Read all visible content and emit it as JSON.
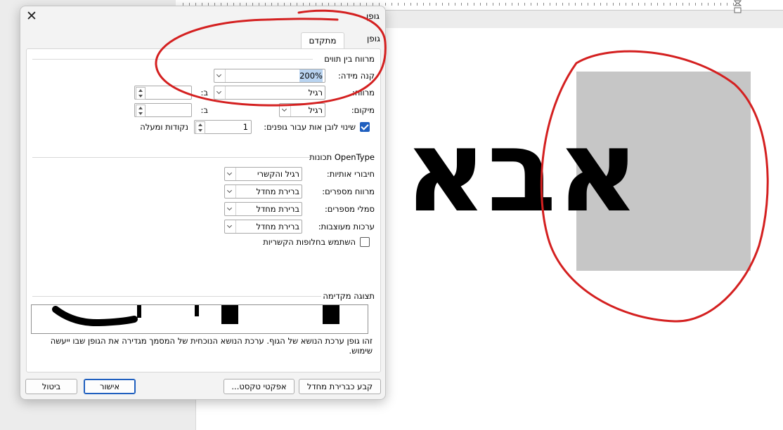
{
  "dialog": {
    "title": "גופן",
    "tabs": [
      {
        "label": "גופן",
        "accelerator": "ן",
        "active": false
      },
      {
        "label": "מתקדם",
        "accelerator": "ם",
        "active": true
      }
    ]
  },
  "spacing": {
    "header": "מרווח בין תווים",
    "scale": {
      "label": "קנה מידה:",
      "value": "200%"
    },
    "spacing": {
      "label": "מרווח:",
      "value": "רגיל",
      "by_label": "ב:",
      "by_value": ""
    },
    "position": {
      "label": "מיקום:",
      "value": "רגיל",
      "by_label": "ב:",
      "by_value": ""
    },
    "kerning": {
      "label": "שינוי לובן אות עבור גופנים:",
      "checked": true,
      "value": "1",
      "unit_label": "נקודות ומעלה"
    }
  },
  "opentype": {
    "header": "תכונות OpenType",
    "ligatures": {
      "label": "חיבורי אותיות:",
      "value": "רגיל והקשרי"
    },
    "number_spacing": {
      "label": "מרווח מספרים:",
      "value": "ברירת מחדל"
    },
    "number_forms": {
      "label": "סמלי מספרים:",
      "value": "ברירת מחדל"
    },
    "stylistic_sets": {
      "label": "ערכות מעוצבות:",
      "value": "ברירת מחדל"
    },
    "contextual_alternates": {
      "label": "השתמש בחלופות הקשריות",
      "checked": false
    }
  },
  "preview": {
    "header": "תצוגה מקדימה",
    "description": "זהו גופן ערכת הנושא של הגוף. ערכת הנושא הנוכחית של המסמך מגדירה את הגופן שבו ייעשה שימוש."
  },
  "buttons": {
    "set_default": "קבע כברירת מחדל",
    "text_effects": "אפקטי טקסט...",
    "ok": "אישור",
    "cancel": "ביטול"
  },
  "document": {
    "text": "אבא"
  },
  "colors": {
    "annotation": "#d42020",
    "selection": "#c6c6c6",
    "primary_button_border": "#1f5fbf"
  }
}
